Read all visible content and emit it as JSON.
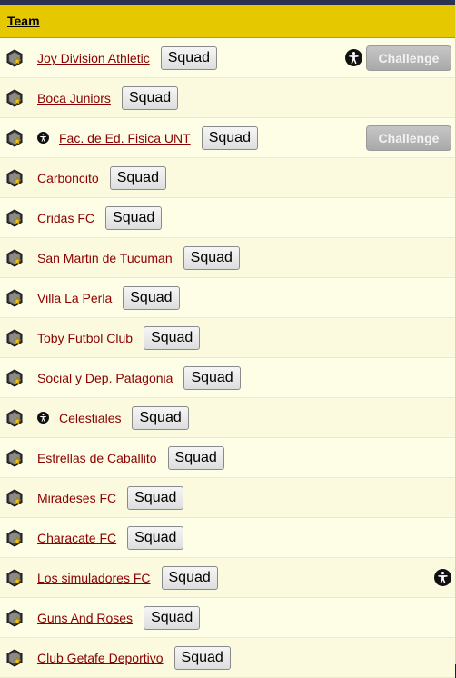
{
  "table": {
    "header": "Team",
    "challenge_label": "Challenge",
    "rows": [
      {
        "team": "Joy Division Athletic",
        "squad": "Squad",
        "small_icon": false,
        "right_icon": true,
        "challenge": true
      },
      {
        "team": "Boca Juniors",
        "squad": "Squad",
        "small_icon": false,
        "right_icon": false,
        "challenge": false
      },
      {
        "team": "Fac. de Ed. Fisica UNT",
        "squad": "Squad",
        "small_icon": true,
        "right_icon": false,
        "challenge": true
      },
      {
        "team": "Carboncito",
        "squad": "Squad",
        "small_icon": false,
        "right_icon": false,
        "challenge": false
      },
      {
        "team": "Cridas FC",
        "squad": "Squad",
        "small_icon": false,
        "right_icon": false,
        "challenge": false
      },
      {
        "team": "San Martin de Tucuman",
        "squad": "Squad",
        "small_icon": false,
        "right_icon": false,
        "challenge": false
      },
      {
        "team": "Villa La Perla",
        "squad": "Squad",
        "small_icon": false,
        "right_icon": false,
        "challenge": false
      },
      {
        "team": "Toby Futbol Club",
        "squad": "Squad",
        "small_icon": false,
        "right_icon": false,
        "challenge": false
      },
      {
        "team": "Social y Dep. Patagonia",
        "squad": "Squad",
        "small_icon": false,
        "right_icon": false,
        "challenge": false
      },
      {
        "team": "Celestiales",
        "squad": "Squad",
        "small_icon": true,
        "right_icon": false,
        "challenge": false
      },
      {
        "team": "Estrellas de Caballito",
        "squad": "Squad",
        "small_icon": false,
        "right_icon": false,
        "challenge": false
      },
      {
        "team": "Miradeses FC",
        "squad": "Squad",
        "small_icon": false,
        "right_icon": false,
        "challenge": false
      },
      {
        "team": "Characate FC",
        "squad": "Squad",
        "small_icon": false,
        "right_icon": false,
        "challenge": false
      },
      {
        "team": "Los simuladores FC",
        "squad": "Squad",
        "small_icon": false,
        "right_icon": true,
        "challenge": false
      },
      {
        "team": "Guns And Roses",
        "squad": "Squad",
        "small_icon": false,
        "right_icon": false,
        "challenge": false
      },
      {
        "team": "Club Getafe Deportivo",
        "squad": "Squad",
        "small_icon": false,
        "right_icon": false,
        "challenge": false
      }
    ]
  },
  "icons": {
    "team_badge": "team-badge-icon",
    "accessibility": "accessibility-icon"
  },
  "colors": {
    "header_bg": "#e5c800",
    "link": "#8b0000",
    "row_bg": "#fefde6",
    "challenge_bg": "#b8b8b8"
  }
}
